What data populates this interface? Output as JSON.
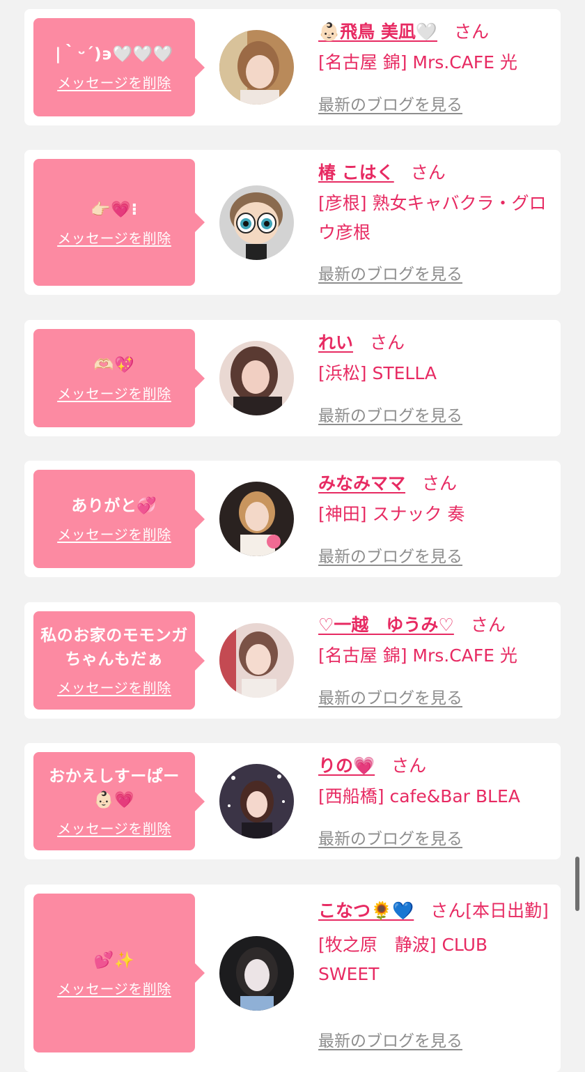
{
  "colors": {
    "page_bg": "#f2f2f2",
    "card_bg": "#ffffff",
    "bubble_bg": "#fc8aa2",
    "accent": "#e72a62",
    "link_gray": "#8d8d8d"
  },
  "labels": {
    "delete_message": "メッセージを削除",
    "view_latest_blog": "最新のブログを見る",
    "honorific": "さん"
  },
  "messages": [
    {
      "text": "|｀ᵕ´)϶🤍🤍🤍",
      "name": "👶🏻飛鳥 美凪🤍",
      "suffix": "",
      "store": "[名古屋 錦] Mrs.CAFE 光",
      "avatar_icon": "profile-photo"
    },
    {
      "text": "👉🏻💗⁝",
      "name": "椿 こはく",
      "suffix": "",
      "store": "[彦根] 熟女キャバクラ・グロウ彦根",
      "avatar_icon": "cartoon-character"
    },
    {
      "text": "🫶🏻💖",
      "name": "れい",
      "suffix": "",
      "store": "[浜松] STELLA",
      "avatar_icon": "profile-photo"
    },
    {
      "text": "ありがと💞",
      "name": "みなみママ",
      "suffix": "",
      "store": "[神田] スナック 奏",
      "avatar_icon": "profile-photo"
    },
    {
      "text": "私のお家のモモンガちゃんもだぁ",
      "name": "♡一越　ゆうみ♡",
      "suffix": "",
      "store": "[名古屋 錦] Mrs.CAFE 光",
      "avatar_icon": "profile-photo"
    },
    {
      "text": "おかえしすーぱー👶🏻💗",
      "name": "りの💗",
      "suffix": "",
      "store": "[西船橋] cafe&Bar BLEA",
      "avatar_icon": "profile-photo"
    },
    {
      "text": "💕✨",
      "name": "こなつ🌻💙",
      "suffix": "[本日出勤]",
      "store": "[牧之原　静波] CLUB SWEET",
      "avatar_icon": "profile-photo"
    }
  ]
}
